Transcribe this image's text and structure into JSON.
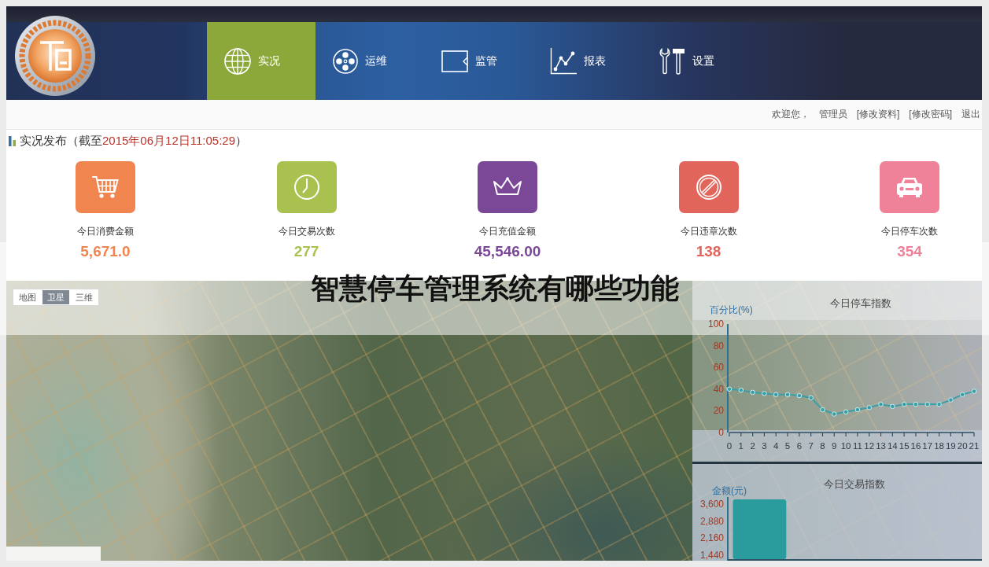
{
  "header": {
    "nav": [
      {
        "label": "实况",
        "kind": "globe",
        "selected": true
      },
      {
        "label": "运维",
        "kind": "reel",
        "selected": false
      },
      {
        "label": "监管",
        "kind": "screen",
        "selected": false
      },
      {
        "label": "报表",
        "kind": "chart",
        "selected": false
      },
      {
        "label": "设置",
        "kind": "tools",
        "selected": false
      }
    ]
  },
  "user_bar": {
    "greeting": "欢迎您，",
    "user": "管理员",
    "links": [
      "[修改资料]",
      "[修改密码]",
      "退出"
    ]
  },
  "section": {
    "title": "实况发布",
    "as_of_open": "（截至",
    "as_of": "2015年06月12日11:05:29",
    "as_of_close": "）"
  },
  "stats": [
    {
      "kind": "cart",
      "label": "今日消费金额",
      "value": "5,671.0",
      "color": "#f0854f"
    },
    {
      "kind": "clock",
      "label": "今日交易次数",
      "value": "277",
      "color": "#a9c24f"
    },
    {
      "kind": "crown",
      "label": "今日充值金额",
      "value": "45,546.00",
      "color": "#7b4898"
    },
    {
      "kind": "forbidden",
      "label": "今日违章次数",
      "value": "138",
      "color": "#e2655b"
    },
    {
      "kind": "car",
      "label": "今日停车次数",
      "value": "354",
      "color": "#ef8198"
    }
  ],
  "map": {
    "map_types": [
      {
        "label": "地图",
        "selected": false
      },
      {
        "label": "卫星",
        "selected": true
      },
      {
        "label": "三维",
        "selected": false
      }
    ]
  },
  "chart_panel": {
    "parking_index": {
      "chart_data": {
        "type": "line",
        "title": "今日停车指数",
        "ylabel": "百分比(%)",
        "x": [
          0,
          1,
          2,
          3,
          4,
          5,
          6,
          7,
          8,
          9,
          10,
          11,
          12,
          13,
          14,
          15,
          16,
          17,
          18,
          19,
          20,
          21
        ],
        "series": [
          {
            "color": "#3a9ea6",
            "marker": true,
            "values": [
              40,
              39,
              37,
              36,
              35,
              35,
              34,
              32,
              21,
              17,
              19,
              21,
              23,
              26,
              24,
              26,
              26,
              26,
              26,
              30,
              35,
              38
            ]
          }
        ],
        "xlim": [
          0,
          21
        ],
        "ylim": [
          0,
          100
        ],
        "xticks": [
          0,
          1,
          2,
          3,
          4,
          5,
          6,
          7,
          8,
          9,
          10,
          11,
          12,
          13,
          14,
          15,
          16,
          17,
          18,
          19,
          20,
          21
        ],
        "yticks": [
          0,
          20,
          40,
          60,
          80,
          100
        ]
      }
    },
    "transaction_index": {
      "chart_data": {
        "type": "bar",
        "title": "今日交易指数",
        "ylabel": "金额(元)",
        "categories": [
          null,
          null,
          null,
          null
        ],
        "series": [
          {
            "color": "#2b9c9e",
            "values": [
              3800,
              null,
              null,
              null
            ]
          }
        ],
        "ylim": [
          1200,
          3900
        ],
        "yticks": [
          {
            "value": 1440,
            "label": "1,440"
          },
          {
            "value": 2160,
            "label": "2,160"
          },
          {
            "value": 2880,
            "label": "2,880"
          },
          {
            "value": 3600,
            "label": "3,600"
          }
        ]
      }
    }
  },
  "overlay_banner": {
    "title": "智慧停车管理系统有哪些功能"
  }
}
